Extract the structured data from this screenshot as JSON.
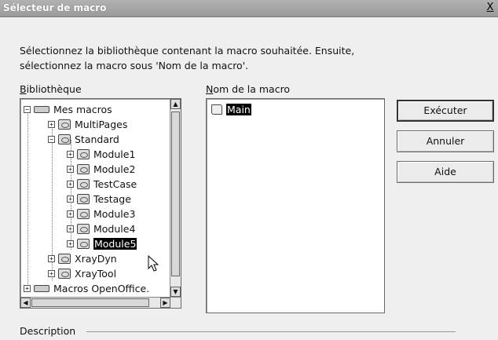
{
  "window": {
    "title": "Sélecteur de macro",
    "close_label": "X"
  },
  "instructions": {
    "line1": "Sélectionnez la bibliothèque contenant la macro souhaitée. Ensuite,",
    "line2": "sélectionnez la macro sous 'Nom de la macro'."
  },
  "library_panel": {
    "label_accel": "B",
    "label_rest": "ibliothèque",
    "items": [
      {
        "label": "Mes macros",
        "icon": "drive-icon",
        "expander": "−"
      },
      {
        "label": "MultiPages",
        "icon": "library-icon",
        "expander": "+"
      },
      {
        "label": "Standard",
        "icon": "library-icon",
        "expander": "−"
      },
      {
        "label": "Module1",
        "icon": "module-icon",
        "expander": "+"
      },
      {
        "label": "Module2",
        "icon": "module-icon",
        "expander": "+"
      },
      {
        "label": "TestCase",
        "icon": "module-icon",
        "expander": "+"
      },
      {
        "label": "Testage",
        "icon": "module-icon",
        "expander": "+"
      },
      {
        "label": "Module3",
        "icon": "module-icon",
        "expander": "+"
      },
      {
        "label": "Module4",
        "icon": "module-icon",
        "expander": "+"
      },
      {
        "label": "Module5",
        "icon": "module-icon",
        "expander": "+",
        "selected": true
      },
      {
        "label": "XrayDyn",
        "icon": "library-icon",
        "expander": "+"
      },
      {
        "label": "XrayTool",
        "icon": "library-icon",
        "expander": "+"
      },
      {
        "label": "Macros OpenOffice.",
        "icon": "drive-icon",
        "expander": "+"
      }
    ]
  },
  "macro_panel": {
    "label_accel": "N",
    "label_rest": "om de la macro",
    "items": [
      {
        "label": "Main",
        "icon": "script-icon",
        "selected": true
      }
    ]
  },
  "buttons": {
    "run": "Exécuter",
    "cancel": "Annuler",
    "help": "Aide"
  },
  "description": {
    "label": "Description"
  }
}
